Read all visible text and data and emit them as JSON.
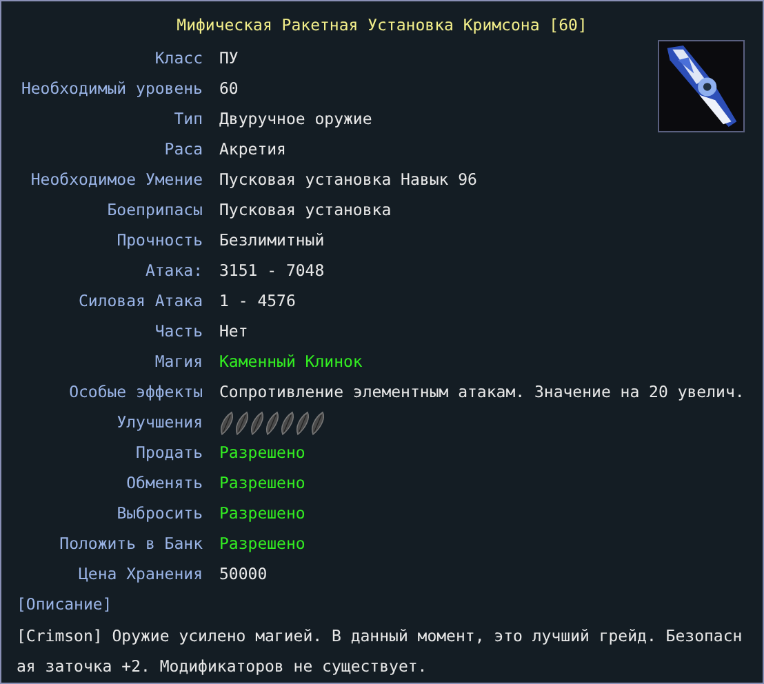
{
  "title": "Мифическая Ракетная Установка Кримсона [60]",
  "properties": [
    {
      "label": "Класс",
      "value": "ПУ"
    },
    {
      "label": "Необходимый уровень",
      "value": "60"
    },
    {
      "label": "Тип",
      "value": "Двуручное оружие"
    },
    {
      "label": "Раса",
      "value": "Акретия"
    },
    {
      "label": "Необходимое Умение",
      "value": "Пусковая установка Навык 96"
    },
    {
      "label": "Боеприпасы",
      "value": "Пусковая установка"
    },
    {
      "label": "Прочность",
      "value": "Безлимитный"
    },
    {
      "label": "Атака:",
      "value": "3151 - 7048"
    },
    {
      "label": "Силовая Атака",
      "value": "1 - 4576"
    },
    {
      "label": "Часть",
      "value": "Нет"
    },
    {
      "label": "Магия",
      "value": "Каменный Клинок",
      "color": "#33ee22"
    },
    {
      "label": "Особые эффекты",
      "value": "Сопротивление элементным атакам. Значение на 20 увелич."
    },
    {
      "label": "Улучшения",
      "slots": [
        {
          "filled": false
        },
        {
          "filled": false
        },
        {
          "filled": false
        },
        {
          "filled": false
        },
        {
          "filled": false
        },
        {
          "filled": false
        },
        {
          "filled": false
        }
      ]
    },
    {
      "label": "Продать",
      "value": "Разрешено",
      "color": "#33ee22"
    },
    {
      "label": "Обменять",
      "value": "Разрешено",
      "color": "#33ee22"
    },
    {
      "label": "Выбросить",
      "value": "Разрешено",
      "color": "#33ee22"
    },
    {
      "label": "Положить в Банк",
      "value": "Разрешено",
      "color": "#33ee22"
    },
    {
      "label": "Цена Хранения",
      "value": "50000"
    }
  ],
  "description": {
    "heading": "[Описание]",
    "text": "[Crimson] Оружие усилено магией. В данный момент, это лучший грейд. Безопасная заточка +2. Модификаторов не существует."
  }
}
